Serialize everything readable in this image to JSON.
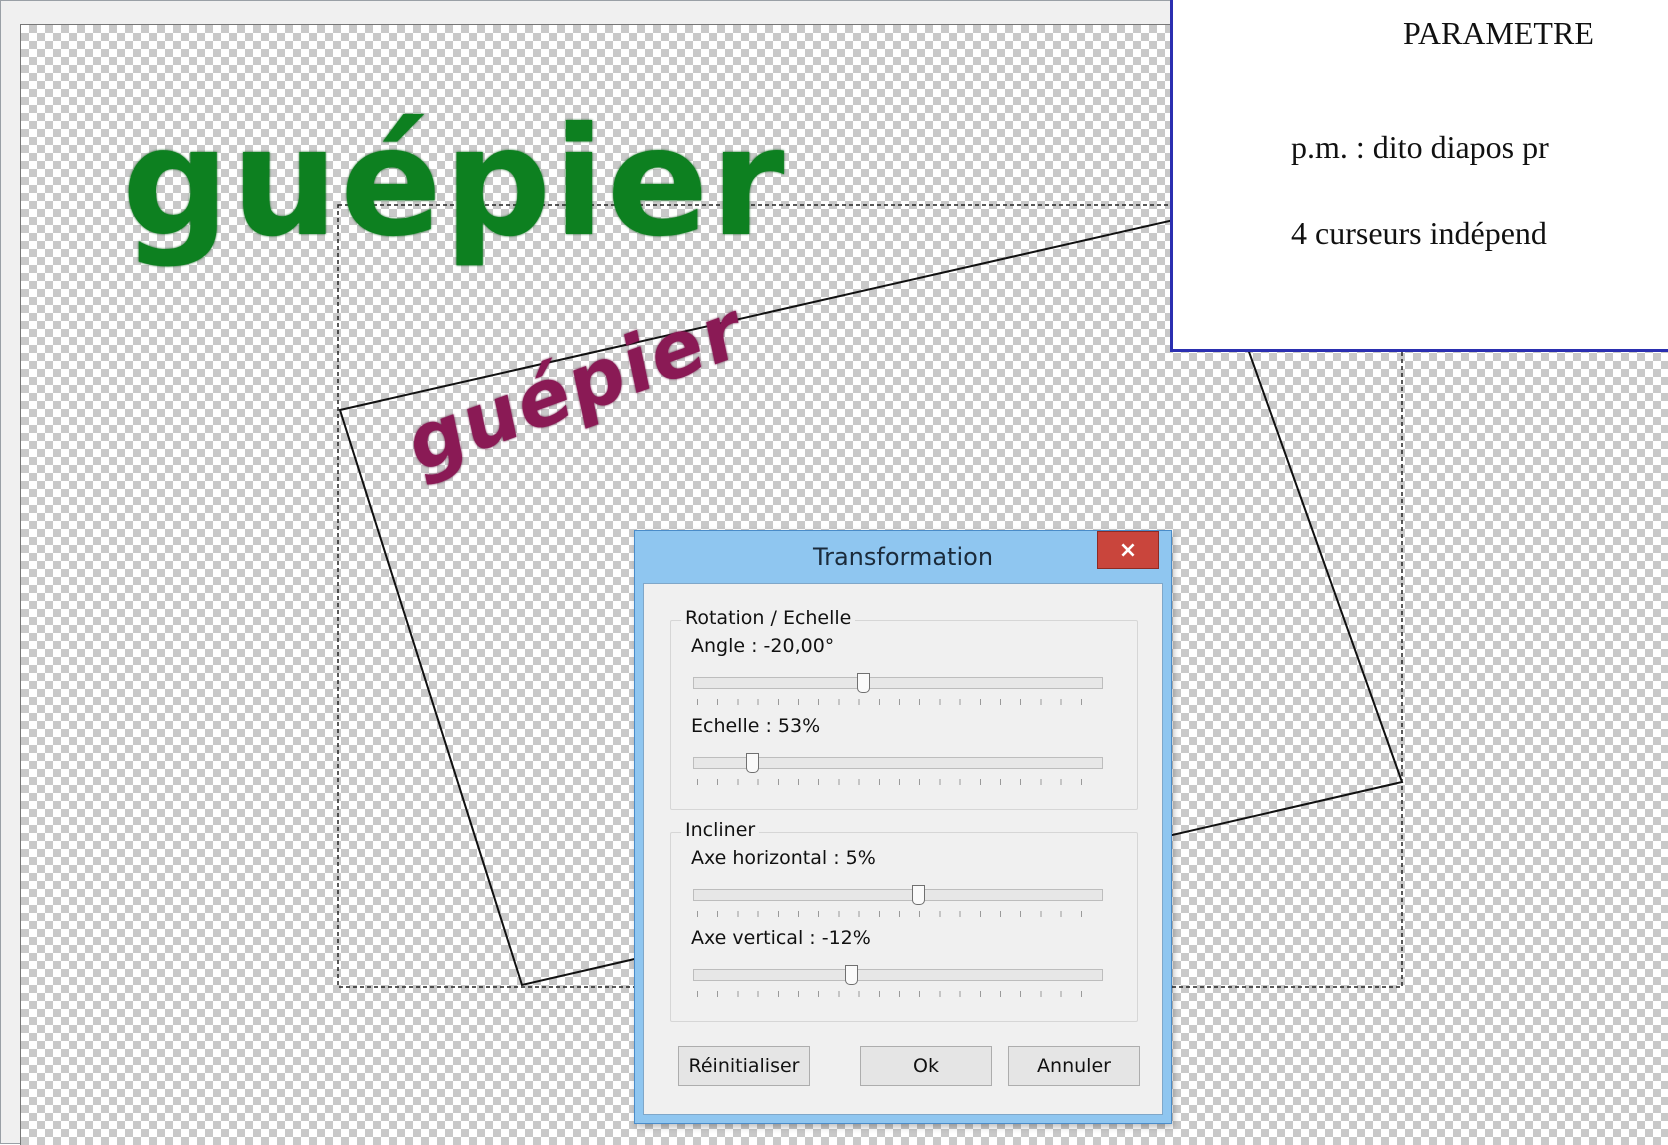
{
  "canvas": {
    "large_word": "guépier",
    "small_word": "guépier",
    "large_word_color": "#0d8020",
    "small_word_color": "#8a1a55"
  },
  "info_box": {
    "title": "PARAMETRE",
    "line1": "p.m. : dito diapos pr",
    "line2": "4 curseurs indépend",
    "border_color": "#2b2fb0"
  },
  "dialog": {
    "title": "Transformation",
    "close_glyph": "×",
    "group_rotation": {
      "legend": "Rotation / Echelle",
      "angle_label": "Angle : -20,00°",
      "angle_fraction": 0.41,
      "scale_label": "Echelle : 53%",
      "scale_fraction": 0.13
    },
    "group_incliner": {
      "legend": "Incliner",
      "horizontal_label": "Axe horizontal : 5%",
      "horizontal_fraction": 0.55,
      "vertical_label": "Axe vertical : -12%",
      "vertical_fraction": 0.38
    },
    "buttons": {
      "reset": "Réinitialiser",
      "ok": "Ok",
      "cancel": "Annuler"
    }
  }
}
